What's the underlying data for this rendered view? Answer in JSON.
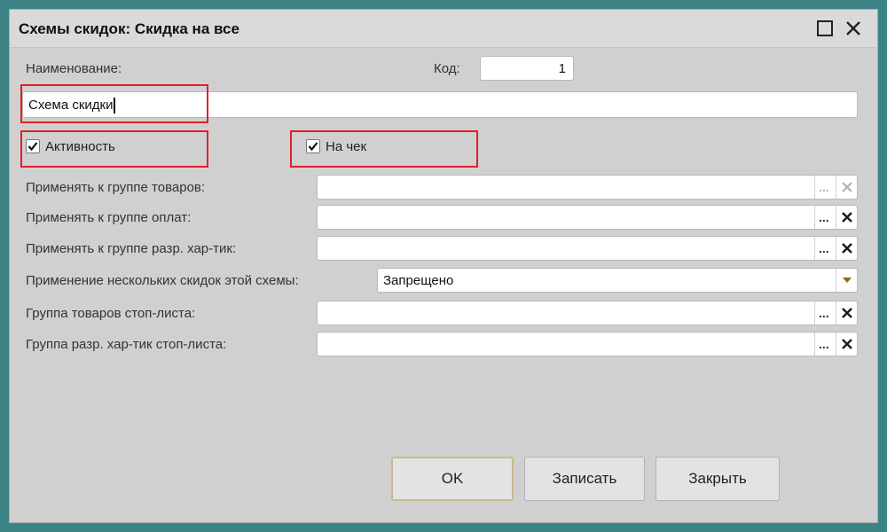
{
  "window": {
    "title": "Схемы скидок: Скидка на все"
  },
  "form": {
    "name_label": "Наименование:",
    "code_label": "Код:",
    "code_value": "1",
    "name_value": "Схема скидки",
    "active_label": "Активность",
    "active_checked": true,
    "receipt_label": "На чек",
    "receipt_checked": true,
    "rows": [
      {
        "label": "Применять к группе товаров:",
        "value": ""
      },
      {
        "label": "Применять к группе оплат:",
        "value": ""
      },
      {
        "label": "Применять к группе разр. хар-тик:",
        "value": ""
      },
      {
        "label": "Применение нескольких скидок этой схемы:",
        "value": "Запрещено"
      },
      {
        "label": "Группа товаров стоп-листа:",
        "value": ""
      },
      {
        "label": "Группа разр. хар-тик стоп-листа:",
        "value": ""
      }
    ]
  },
  "buttons": {
    "ok": "OK",
    "save": "Записать",
    "close": "Закрыть"
  },
  "colors": {
    "highlight": "#e0202a",
    "clear_icon": "#1a1a1a",
    "dropdown_arrow": "#8a6d00"
  }
}
